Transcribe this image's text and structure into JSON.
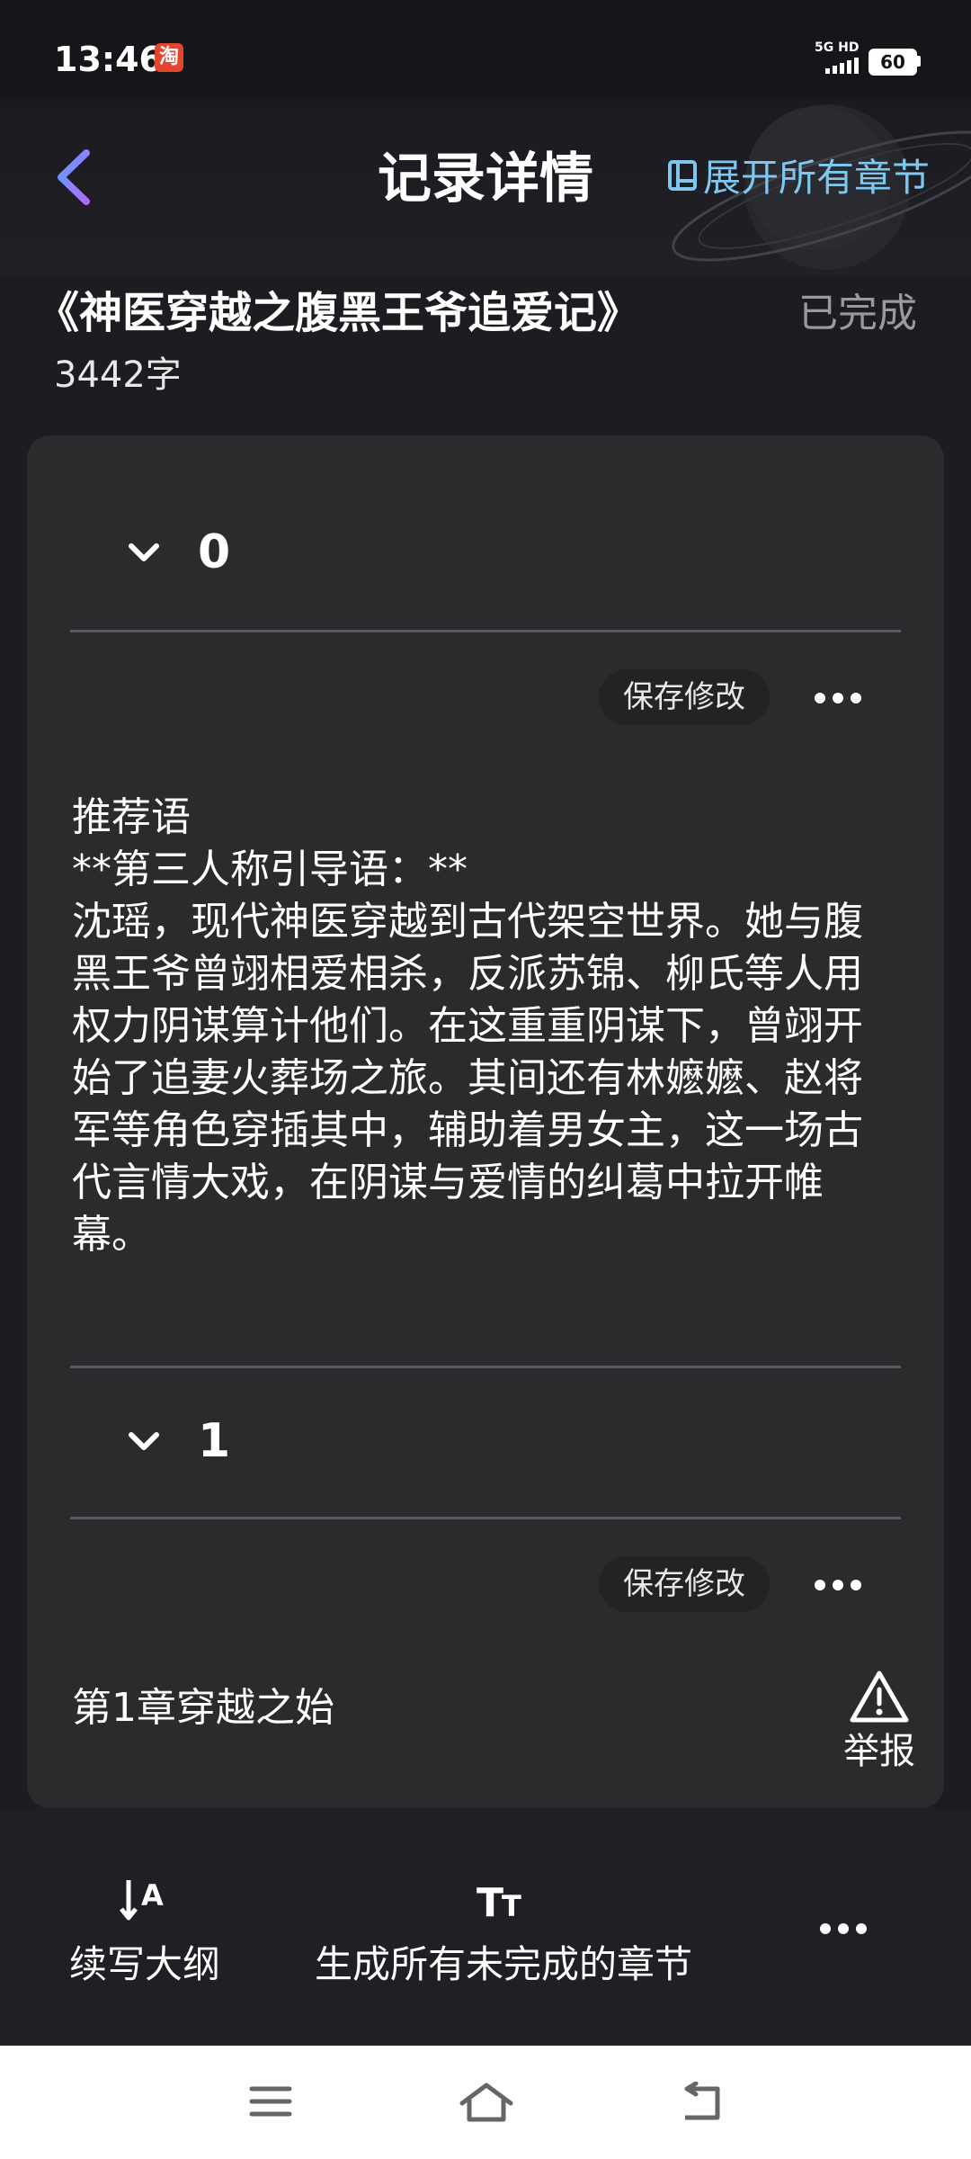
{
  "status_bar": {
    "time": "13:46",
    "app_badge": "淘",
    "network": "5G HD",
    "battery": "60"
  },
  "header": {
    "title": "记录详情",
    "expand_label": "展开所有章节",
    "accent": "#7ec8f0"
  },
  "book": {
    "title": "《神医穿越之腹黑王爷追爱记》",
    "status": "已完成",
    "word_count": "3442字"
  },
  "chapters": [
    {
      "number": "0",
      "save_label": "保存修改",
      "content": "推荐语\n**第三人称引导语：**\n沈瑶，现代神医穿越到古代架空世界。她与腹黑王爷曾翊相爱相杀，反派苏锦、柳氏等人用权力阴谋算计他们。在这重重阴谋下，曾翊开始了追妻火葬场之旅。其间还有林嬷嬷、赵将军等角色穿插其中，辅助着男女主，这一场古代言情大戏，在阴谋与爱情的纠葛中拉开帷幕。"
    },
    {
      "number": "1",
      "save_label": "保存修改",
      "content": "第1章穿越之始"
    }
  ],
  "report_label": "举报",
  "toolbar": {
    "continue_outline": "续写大纲",
    "generate_all": "生成所有未完成的章节"
  }
}
